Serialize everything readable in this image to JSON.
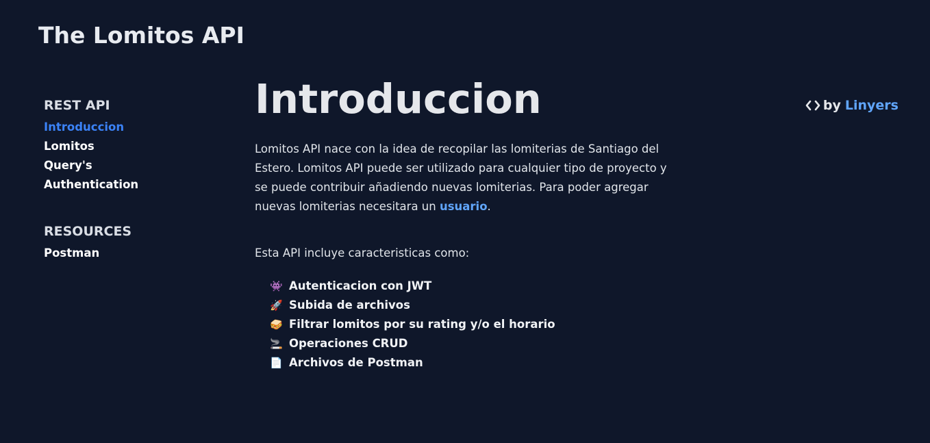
{
  "site": {
    "title": "The Lomitos API"
  },
  "sidebar": {
    "sections": [
      {
        "heading": "REST API",
        "items": [
          {
            "label": "Introduccion",
            "active": true
          },
          {
            "label": "Lomitos"
          },
          {
            "label": "Query's"
          },
          {
            "label": "Authentication"
          }
        ]
      },
      {
        "heading": "RESOURCES",
        "items": [
          {
            "label": "Postman"
          }
        ]
      }
    ]
  },
  "main": {
    "title": "Introduccion",
    "intro_text": "Lomitos API nace con la idea de recopilar las lomiterias de Santiago del Estero. Lomitos API puede ser utilizado para cualquier tipo de proyecto y se puede contribuir añadiendo nuevas lomiterias. Para poder agregar nuevas lomiterias necesitara un ",
    "intro_link": "usuario",
    "intro_end": ".",
    "features_intro": "Esta API incluye caracteristicas como:",
    "features": [
      {
        "emoji": "👾",
        "label": "Autenticacion con JWT"
      },
      {
        "emoji": "🚀",
        "label": "Subida de archivos"
      },
      {
        "emoji": "🥪",
        "label": "Filtrar lomitos por su rating y/o el horario"
      },
      {
        "emoji": "🚬",
        "label": "Operaciones CRUD"
      },
      {
        "emoji": "📄",
        "label": "Archivos de Postman"
      }
    ]
  },
  "byline": {
    "icon": "code-icon",
    "prefix": "by",
    "author": "Linyers"
  },
  "colors": {
    "background": "#0f172a",
    "accent": "#3b82f6",
    "link": "#60a5fa"
  }
}
